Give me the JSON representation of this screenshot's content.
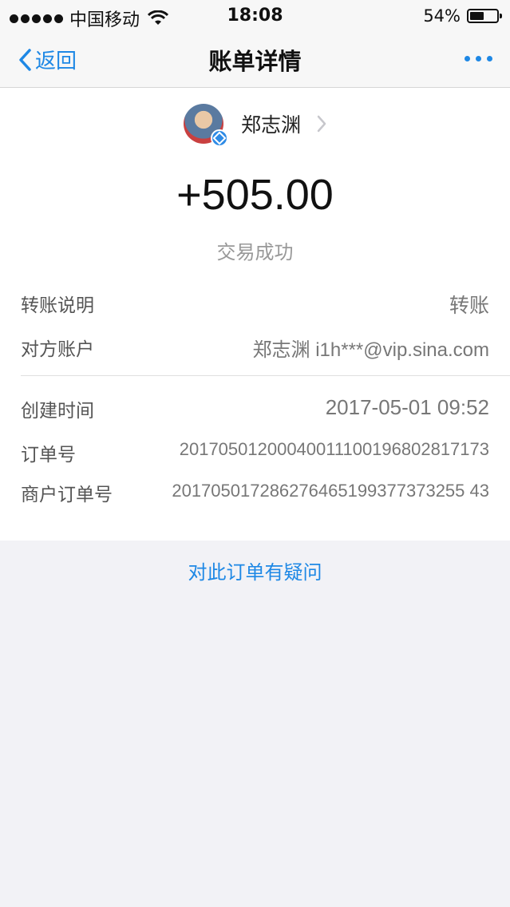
{
  "status_bar": {
    "carrier": "中国移动",
    "time": "18:08",
    "battery_percent": "54%",
    "battery_level": 0.54
  },
  "nav": {
    "back_label": "返回",
    "title": "账单详情",
    "more_icon": "more-dots-icon"
  },
  "user": {
    "name": "郑志渊"
  },
  "transaction": {
    "amount": "+505.00",
    "status": "交易成功"
  },
  "details": [
    {
      "label": "转账说明",
      "value": "转账"
    },
    {
      "label": "对方账户",
      "value": "郑志渊 i1h***@vip.sina.com"
    },
    {
      "label": "创建时间",
      "value": "2017-05-01 09:52"
    },
    {
      "label": "订单号",
      "value": "20170501200040011100196802817173"
    },
    {
      "label": "商户订单号",
      "value": "201705017286276465199377373255 43"
    }
  ],
  "footer": {
    "question_link": "对此订单有疑问"
  },
  "colors": {
    "accent": "#1e88e5",
    "background": "#f2f2f6"
  }
}
